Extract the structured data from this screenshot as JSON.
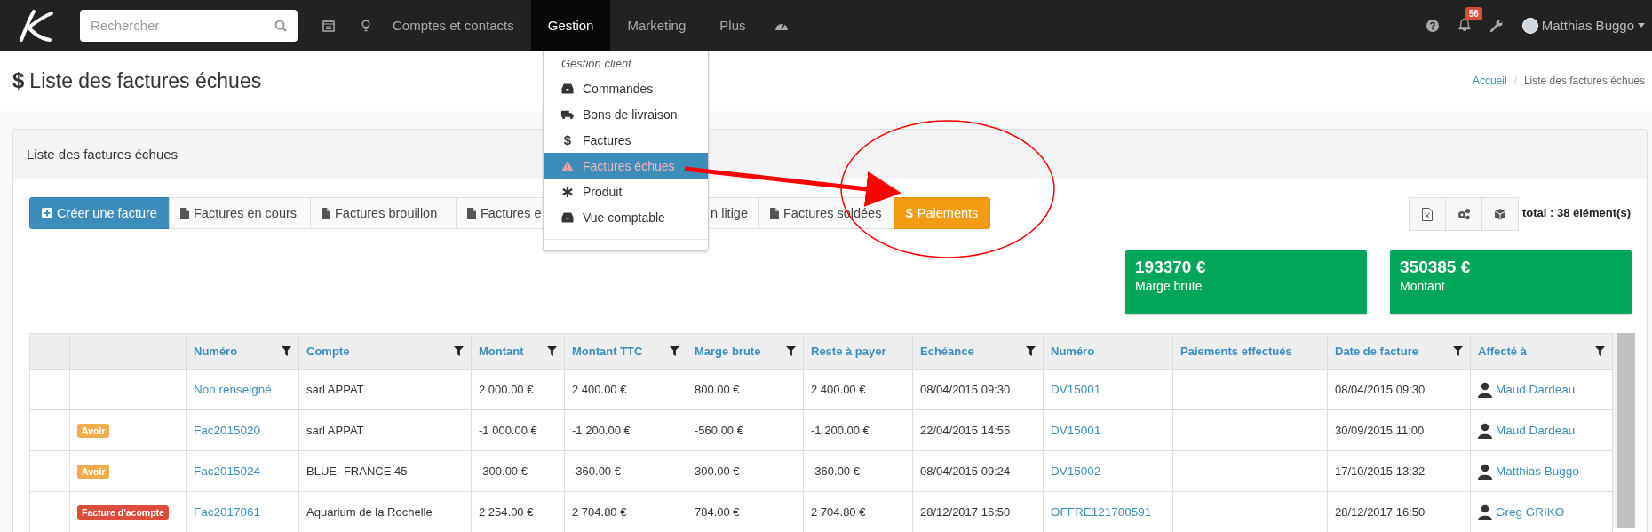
{
  "navbar": {
    "search": {
      "placeholder": "Rechercher"
    },
    "menu": [
      {
        "label": "Comptes et contacts",
        "selected": false
      },
      {
        "label": "Gestion",
        "selected": true
      },
      {
        "label": "Marketing",
        "selected": false
      },
      {
        "label": "Plus",
        "selected": false
      }
    ],
    "notifications": "56",
    "user": "Matthias Buggo"
  },
  "dropdown": {
    "header": "Gestion client",
    "items": [
      {
        "label": "Commandes",
        "kind": "inbox",
        "selected": false
      },
      {
        "label": "Bons de livraison",
        "kind": "truck",
        "selected": false
      },
      {
        "label": "Factures",
        "kind": "dollar",
        "glyph": "$",
        "selected": false
      },
      {
        "label": "Factures échues",
        "kind": "warning",
        "selected": true
      },
      {
        "label": "Produit",
        "kind": "asterisk",
        "selected": false
      },
      {
        "label": "Vue comptable",
        "kind": "inbox",
        "selected": false
      }
    ]
  },
  "page_title": {
    "icon": "$",
    "text": "Liste des factures échues"
  },
  "breadcrumb": [
    {
      "label": "Accueil",
      "kind": "link"
    },
    {
      "label": "Liste des factures échues",
      "kind": "current",
      "separator": "/"
    }
  ],
  "panel": {
    "title": "Liste des factures échues",
    "tabs": [
      {
        "label": "Créer une facture",
        "kind": "create"
      },
      {
        "label": "Factures en cours",
        "kind": "file"
      },
      {
        "label": "Factures brouillon",
        "kind": "file"
      },
      {
        "label": "Factures e",
        "kind": "file"
      },
      {
        "label": "n litige",
        "kind": "cut"
      },
      {
        "label": "Factures soldées",
        "kind": "file"
      },
      {
        "label": "Paiements",
        "kind": "payments",
        "glyph": "$"
      }
    ],
    "total": "total : 38 élément(s)",
    "stats": [
      {
        "value": "193370 €",
        "label": "Marge brute"
      },
      {
        "value": "350385 €",
        "label": "Montant"
      }
    ]
  },
  "table": {
    "columns": [
      {
        "label": "Numéro",
        "filter": true
      },
      {
        "label": "Compte",
        "filter": true
      },
      {
        "label": "Montant",
        "filter": true
      },
      {
        "label": "Montant TTC",
        "filter": true
      },
      {
        "label": "Marge brute",
        "filter": true
      },
      {
        "label": "Reste à payer",
        "filter": false
      },
      {
        "label": "Echéance",
        "filter": true
      },
      {
        "label": "Numéro",
        "filter": false
      },
      {
        "label": "Paiements effectués",
        "filter": false
      },
      {
        "label": "Date de facture",
        "filter": true
      },
      {
        "label": "Affecté à",
        "filter": true
      }
    ],
    "rows": [
      {
        "cells": [
          "Non renseigné",
          "sarl APPAT",
          "2 000.00 €",
          "2 400.00 €",
          "800.00 €",
          "2 400.00 €",
          "08/04/2015 09:30",
          "DV15001",
          "",
          "08/04/2015 09:30",
          "Maud Dardeau"
        ]
      },
      {
        "badge": {
          "label": "Avoir",
          "color": "#f0ad4e"
        },
        "cells": [
          "Fac2015020",
          "sarl APPAT",
          "-1 000.00 €",
          "-1 200.00 €",
          "-560.00 €",
          "-1 200.00 €",
          "22/04/2015 14:55",
          "DV15001",
          "",
          "30/09/2015 11:00",
          "Maud Dardeau"
        ]
      },
      {
        "badge": {
          "label": "Avoir",
          "color": "#f0ad4e"
        },
        "cells": [
          "Fac2015024",
          "BLUE- FRANCE 45",
          "-300.00 €",
          "-360.00 €",
          "300.00 €",
          "-360.00 €",
          "08/04/2015 09:24",
          "DV15002",
          "",
          "17/10/2015 13:32",
          "Matthias Buggo"
        ]
      },
      {
        "badge": {
          "label": "Facture d'acompte",
          "color": "#dd4b39"
        },
        "cells": [
          "Fac2017061",
          "Aquarium de la Rochelle",
          "2 254.00 €",
          "2 704.80 €",
          "784.00 €",
          "2 704.80 €",
          "28/12/2017 16:50",
          "OFFRE121700591",
          "",
          "28/12/2017 16:50",
          "Greg GRIKO"
        ]
      }
    ]
  }
}
